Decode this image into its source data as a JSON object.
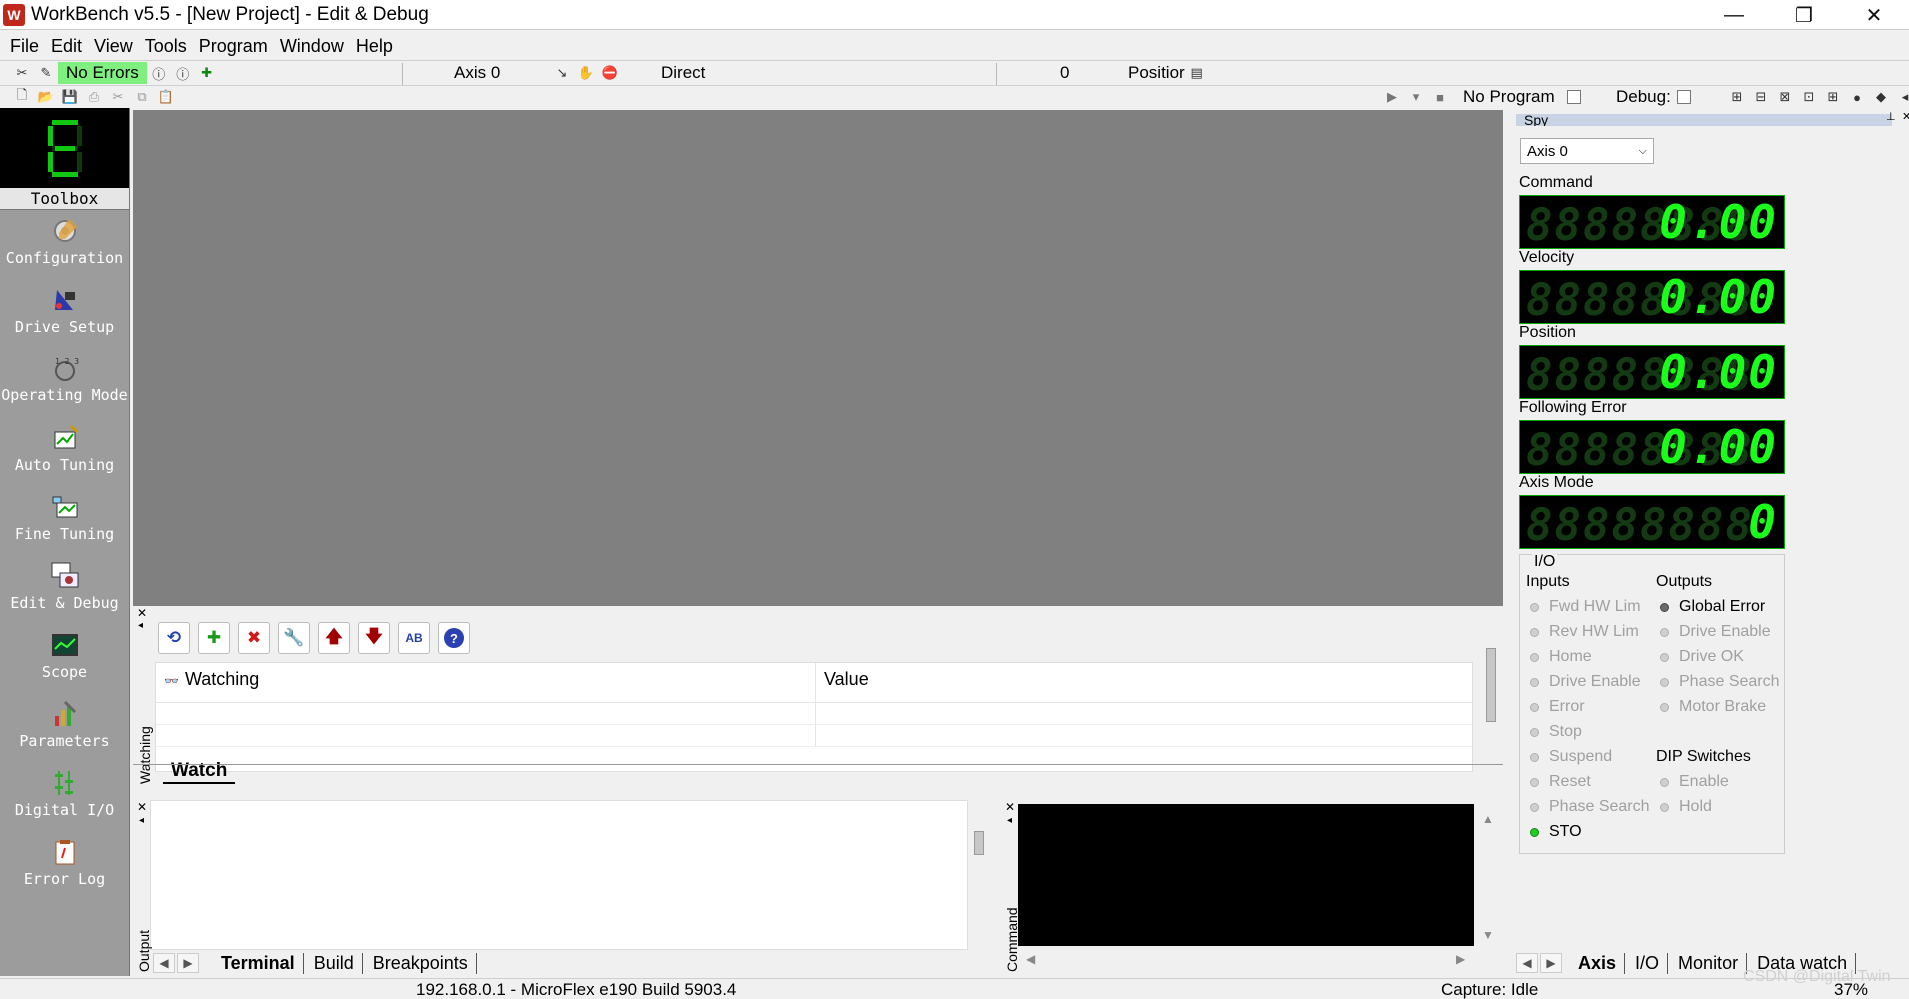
{
  "window": {
    "title": "WorkBench v5.5 - [New Project] - Edit & Debug",
    "minimize": "—",
    "maximize": "❐",
    "close": "✕"
  },
  "menu": [
    "File",
    "Edit",
    "View",
    "Tools",
    "Program",
    "Window",
    "Help"
  ],
  "toolbar1": {
    "status": "No Errors",
    "axis": "Axis 0",
    "mode": "Direct",
    "value": "0",
    "position_label": "Positior"
  },
  "toolbar2": {
    "program": "No Program",
    "debug_label": "Debug:"
  },
  "toolbox": {
    "title": "Toolbox",
    "items": [
      {
        "label": "Configuration",
        "icon": "configuration-icon"
      },
      {
        "label": "Drive Setup",
        "icon": "drive-setup-icon"
      },
      {
        "label": "Operating Mode",
        "icon": "operating-mode-icon"
      },
      {
        "label": "Auto Tuning",
        "icon": "auto-tuning-icon"
      },
      {
        "label": "Fine Tuning",
        "icon": "fine-tuning-icon"
      },
      {
        "label": "Edit & Debug",
        "icon": "edit-debug-icon"
      },
      {
        "label": "Scope",
        "icon": "scope-icon"
      },
      {
        "label": "Parameters",
        "icon": "parameters-icon"
      },
      {
        "label": "Digital I/O",
        "icon": "digital-io-icon"
      },
      {
        "label": "Error Log",
        "icon": "error-log-icon"
      }
    ]
  },
  "watch": {
    "col_watching": "Watching",
    "col_value": "Value",
    "tab": "Watch",
    "side_label": "Watching"
  },
  "bottom_tabs": {
    "terminal": "Terminal",
    "build": "Build",
    "breakpoints": "Breakpoints",
    "output_side": "Output",
    "command_side": "Command"
  },
  "spy": {
    "title": "Spy",
    "axis_select": "Axis 0",
    "readouts": [
      {
        "label": "Command",
        "value": "0.00"
      },
      {
        "label": "Velocity",
        "value": "0.00"
      },
      {
        "label": "Position",
        "value": "0.00"
      },
      {
        "label": "Following Error",
        "value": "0.00"
      },
      {
        "label": "Axis Mode",
        "value": "0"
      }
    ],
    "ghost_digits": "88888888",
    "io": {
      "title": "I/O",
      "inputs_label": "Inputs",
      "outputs_label": "Outputs",
      "dip_label": "DIP Switches",
      "inputs": [
        "Fwd HW Lim",
        "Rev HW Lim",
        "Home",
        "Drive Enable",
        "Error",
        "Stop",
        "Suspend",
        "Reset",
        "Phase Search",
        "STO"
      ],
      "outputs": [
        "Global Error",
        "Drive Enable",
        "Drive OK",
        "Phase Search",
        "Motor Brake"
      ],
      "dip": [
        "Enable",
        "Hold"
      ]
    },
    "tabs": [
      "Axis",
      "I/O",
      "Monitor",
      "Data watch"
    ]
  },
  "status": {
    "connection": "192.168.0.1 - MicroFlex e190 Build 5903.4",
    "capture": "Capture: Idle",
    "zoom": "37%"
  },
  "watermark": "CSDN @Digital Twin",
  "colors": {
    "no_errors_bg": "#7ff07f",
    "display_green": "#19ff19",
    "toolbox_bg": "#9c9c9c",
    "editor_bg": "#808080"
  }
}
